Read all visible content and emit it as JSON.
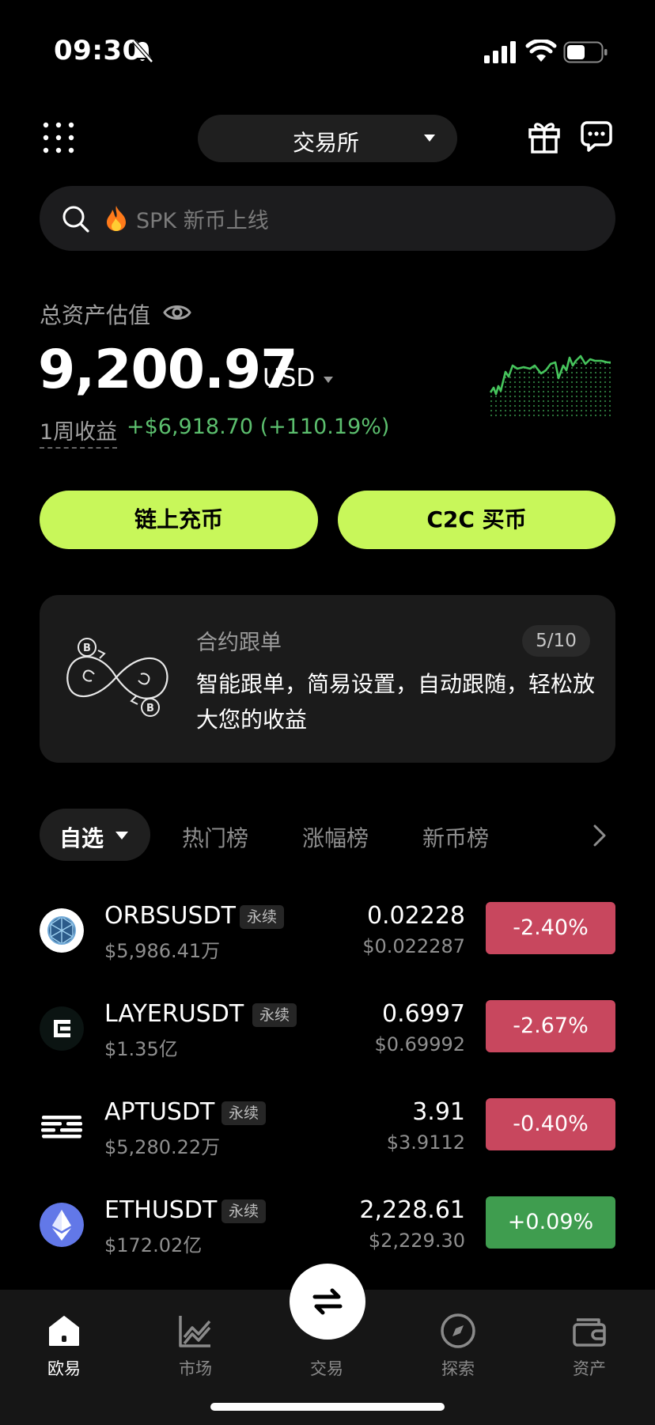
{
  "status_bar": {
    "time": "09:30"
  },
  "header": {
    "exchange_label": "交易所"
  },
  "search": {
    "placeholder": "SPK 新币上线"
  },
  "assets": {
    "label": "总资产估值",
    "value": "9,200.97",
    "unit": "USD",
    "pnl_label": "1周收益",
    "pnl_value": "+$6,918.70 (+110.19%)",
    "accent_color": "#5cbf6e"
  },
  "actions": {
    "deposit_label": "链上充币",
    "c2c_label": "C2C 买币",
    "button_color": "#c8f75a"
  },
  "promo_card": {
    "title": "合约跟单",
    "badge": "5/10",
    "text": "智能跟单，简易设置，自动跟随，轻松放大您的收益"
  },
  "tabs": {
    "active": "自选",
    "hot": "热门榜",
    "gainers": "涨幅榜",
    "new": "新币榜"
  },
  "market": {
    "rows": [
      {
        "icon": "orbs-logo",
        "pair": "ORBSUSDT",
        "tag": "永续",
        "volume": "$5,986.41万",
        "price": "0.02228",
        "fiat": "$0.022287",
        "change": "-2.40%",
        "direction": "down"
      },
      {
        "icon": "layer-logo",
        "pair": "LAYERUSDT",
        "tag": "永续",
        "volume": "$1.35亿",
        "price": "0.6997",
        "fiat": "$0.69992",
        "change": "-2.67%",
        "direction": "down"
      },
      {
        "icon": "aptos-logo",
        "pair": "APTUSDT",
        "tag": "永续",
        "volume": "$5,280.22万",
        "price": "3.91",
        "fiat": "$3.9112",
        "change": "-0.40%",
        "direction": "down"
      },
      {
        "icon": "ethereum-logo",
        "pair": "ETHUSDT",
        "tag": "永续",
        "volume": "$172.02亿",
        "price": "2,228.61",
        "fiat": "$2,229.30",
        "change": "+0.09%",
        "direction": "up"
      }
    ],
    "down_color": "#c8475e",
    "up_color": "#3f9d4f"
  },
  "bottom_nav": {
    "home": "欧易",
    "market": "市场",
    "trade": "交易",
    "discover": "探索",
    "assets": "资产"
  }
}
